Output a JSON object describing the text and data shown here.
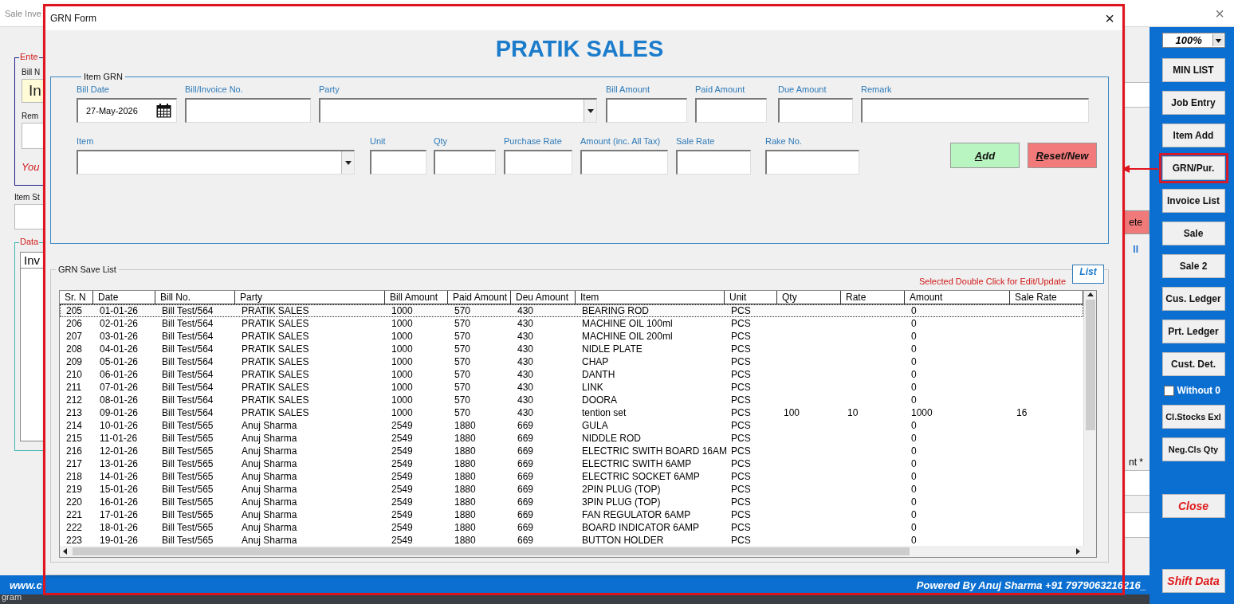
{
  "background_window": {
    "title": "Sale Inve",
    "close": "×",
    "left_fragments": {
      "entry_legend": "Ente",
      "bill_label": "Bill N",
      "bill_value": "In",
      "remark_label": "Rem",
      "note": "You",
      "stock_label": "Item St",
      "data_legend": "Data",
      "list_header": "Inv"
    },
    "right_fragments": {
      "button": "ete",
      "link": "ll",
      "label": "nt *"
    },
    "footer": {
      "website": "www.c",
      "credit": "Powered By Anuj Sharma +91 7979063216216_"
    }
  },
  "desktop_text": "gram",
  "sidebar": {
    "zoom": "100%",
    "items": [
      {
        "kind": "button",
        "label": "MIN LIST",
        "highlighted": false
      },
      {
        "kind": "button",
        "label": "Job Entry",
        "highlighted": false
      },
      {
        "kind": "button",
        "label": "Item Add",
        "highlighted": false
      },
      {
        "kind": "button",
        "label": "GRN/Pur.",
        "highlighted": true
      },
      {
        "kind": "button",
        "label": "Invoice List",
        "highlighted": false
      },
      {
        "kind": "button",
        "label": "Sale",
        "highlighted": false
      },
      {
        "kind": "button",
        "label": "Sale 2",
        "highlighted": false
      },
      {
        "kind": "button",
        "label": "Cus. Ledger",
        "highlighted": false
      },
      {
        "kind": "button",
        "label": "Prt. Ledger",
        "highlighted": false
      },
      {
        "kind": "button",
        "label": "Cust. Det.",
        "highlighted": false
      },
      {
        "kind": "checkbox",
        "label": "Without 0",
        "checked": false
      },
      {
        "kind": "small",
        "label": "Cl.Stocks Exl",
        "highlighted": false
      },
      {
        "kind": "small",
        "label": "Neg.Cls Qty",
        "highlighted": false
      },
      {
        "kind": "danger",
        "label": "Close",
        "highlighted": false
      },
      {
        "kind": "danger",
        "label": "Shift Data",
        "highlighted": false
      }
    ]
  },
  "dialog": {
    "title": "GRN Form",
    "close": "×",
    "heading": "PRATIK SALES",
    "item_grn": {
      "legend": "Item GRN",
      "row_1": [
        {
          "kind": "date",
          "label": "Bill Date",
          "value": "27-May-2026"
        },
        {
          "kind": "text",
          "label": "Bill/Invoice No."
        },
        {
          "kind": "combo",
          "label": "Party"
        },
        {
          "kind": "text",
          "label": "Bill Amount"
        },
        {
          "kind": "text",
          "label": "Paid Amount"
        },
        {
          "kind": "text",
          "label": "Due Amount"
        },
        {
          "kind": "text",
          "label": "Remark"
        }
      ],
      "row_2": [
        {
          "kind": "combo",
          "label": "Item"
        },
        {
          "kind": "text",
          "label": "Unit"
        },
        {
          "kind": "text",
          "label": "Qty"
        },
        {
          "kind": "text",
          "label": "Purchase Rate"
        },
        {
          "kind": "text",
          "label": "Amount (inc. All Tax)"
        },
        {
          "kind": "text",
          "label": "Sale Rate"
        },
        {
          "kind": "text",
          "label": "Rake No."
        }
      ],
      "buttons": [
        {
          "kind": "add",
          "label": "Add"
        },
        {
          "kind": "reset",
          "label": "Reset/New"
        }
      ]
    },
    "save_list": {
      "legend": "GRN Save List",
      "note": "Selected Double Click for Edit/Update",
      "list_button": "List",
      "columns": [
        "Sr. N",
        "Date",
        "Bill No.",
        "Party",
        "Bill Amount",
        "Paid Amount",
        "Deu Amount",
        "Item",
        "Unit",
        "Qty",
        "Rate",
        "Amount",
        "Sale Rate"
      ],
      "rows": [
        {
          "selected": true,
          "sr": "205",
          "date": "01-01-26",
          "bill_no": "Bill Test/564",
          "party": "PRATIK SALES",
          "bill_amount": "1000",
          "paid_amount": "570",
          "due_amount": "430",
          "item": "BEARING ROD",
          "unit": "PCS",
          "amount": "0"
        },
        {
          "selected": false,
          "sr": "206",
          "date": "02-01-26",
          "bill_no": "Bill Test/564",
          "party": "PRATIK SALES",
          "bill_amount": "1000",
          "paid_amount": "570",
          "due_amount": "430",
          "item": "MACHINE OIL 100ml",
          "unit": "PCS",
          "amount": "0"
        },
        {
          "selected": false,
          "sr": "207",
          "date": "03-01-26",
          "bill_no": "Bill Test/564",
          "party": "PRATIK SALES",
          "bill_amount": "1000",
          "paid_amount": "570",
          "due_amount": "430",
          "item": "MACHINE OIL 200ml",
          "unit": "PCS",
          "amount": "0"
        },
        {
          "selected": false,
          "sr": "208",
          "date": "04-01-26",
          "bill_no": "Bill Test/564",
          "party": "PRATIK SALES",
          "bill_amount": "1000",
          "paid_amount": "570",
          "due_amount": "430",
          "item": "NIDLE PLATE",
          "unit": "PCS",
          "amount": "0"
        },
        {
          "selected": false,
          "sr": "209",
          "date": "05-01-26",
          "bill_no": "Bill Test/564",
          "party": "PRATIK SALES",
          "bill_amount": "1000",
          "paid_amount": "570",
          "due_amount": "430",
          "item": "CHAP",
          "unit": "PCS",
          "amount": "0"
        },
        {
          "selected": false,
          "sr": "210",
          "date": "06-01-26",
          "bill_no": "Bill Test/564",
          "party": "PRATIK SALES",
          "bill_amount": "1000",
          "paid_amount": "570",
          "due_amount": "430",
          "item": "DANTH",
          "unit": "PCS",
          "amount": "0"
        },
        {
          "selected": false,
          "sr": "211",
          "date": "07-01-26",
          "bill_no": "Bill Test/564",
          "party": "PRATIK SALES",
          "bill_amount": "1000",
          "paid_amount": "570",
          "due_amount": "430",
          "item": "LINK",
          "unit": "PCS",
          "amount": "0"
        },
        {
          "selected": false,
          "sr": "212",
          "date": "08-01-26",
          "bill_no": "Bill Test/564",
          "party": "PRATIK SALES",
          "bill_amount": "1000",
          "paid_amount": "570",
          "due_amount": "430",
          "item": "DOORA",
          "unit": "PCS",
          "amount": "0"
        },
        {
          "selected": false,
          "sr": "213",
          "date": "09-01-26",
          "bill_no": "Bill Test/564",
          "party": "PRATIK SALES",
          "bill_amount": "1000",
          "paid_amount": "570",
          "due_amount": "430",
          "item": "tention set",
          "unit": "PCS",
          "qty": "100",
          "rate": "10",
          "amount": "1000",
          "sale_rate": "16"
        },
        {
          "selected": false,
          "sr": "214",
          "date": "10-01-26",
          "bill_no": "Bill Test/565",
          "party": "Anuj Sharma",
          "bill_amount": "2549",
          "paid_amount": "1880",
          "due_amount": "669",
          "item": "GULA",
          "unit": "PCS",
          "amount": "0"
        },
        {
          "selected": false,
          "sr": "215",
          "date": "11-01-26",
          "bill_no": "Bill Test/565",
          "party": "Anuj Sharma",
          "bill_amount": "2549",
          "paid_amount": "1880",
          "due_amount": "669",
          "item": "NIDDLE ROD",
          "unit": "PCS",
          "amount": "0"
        },
        {
          "selected": false,
          "sr": "216",
          "date": "12-01-26",
          "bill_no": "Bill Test/565",
          "party": "Anuj Sharma",
          "bill_amount": "2549",
          "paid_amount": "1880",
          "due_amount": "669",
          "item": "ELECTRIC SWITH BOARD 16AM",
          "unit": "PCS",
          "amount": "0"
        },
        {
          "selected": false,
          "sr": "217",
          "date": "13-01-26",
          "bill_no": "Bill Test/565",
          "party": "Anuj Sharma",
          "bill_amount": "2549",
          "paid_amount": "1880",
          "due_amount": "669",
          "item": "ELECTRIC SWITH 6AMP",
          "unit": "PCS",
          "amount": "0"
        },
        {
          "selected": false,
          "sr": "218",
          "date": "14-01-26",
          "bill_no": "Bill Test/565",
          "party": "Anuj Sharma",
          "bill_amount": "2549",
          "paid_amount": "1880",
          "due_amount": "669",
          "item": "ELECTRIC SOCKET 6AMP",
          "unit": "PCS",
          "amount": "0"
        },
        {
          "selected": false,
          "sr": "219",
          "date": "15-01-26",
          "bill_no": "Bill Test/565",
          "party": "Anuj Sharma",
          "bill_amount": "2549",
          "paid_amount": "1880",
          "due_amount": "669",
          "item": "2PIN PLUG (TOP)",
          "unit": "PCS",
          "amount": "0"
        },
        {
          "selected": false,
          "sr": "220",
          "date": "16-01-26",
          "bill_no": "Bill Test/565",
          "party": "Anuj Sharma",
          "bill_amount": "2549",
          "paid_amount": "1880",
          "due_amount": "669",
          "item": "3PIN PLUG (TOP)",
          "unit": "PCS",
          "amount": "0"
        },
        {
          "selected": false,
          "sr": "221",
          "date": "17-01-26",
          "bill_no": "Bill Test/565",
          "party": "Anuj Sharma",
          "bill_amount": "2549",
          "paid_amount": "1880",
          "due_amount": "669",
          "item": "FAN REGULATOR 6AMP",
          "unit": "PCS",
          "amount": "0"
        },
        {
          "selected": false,
          "sr": "222",
          "date": "18-01-26",
          "bill_no": "Bill Test/565",
          "party": "Anuj Sharma",
          "bill_amount": "2549",
          "paid_amount": "1880",
          "due_amount": "669",
          "item": "BOARD INDICATOR 6AMP",
          "unit": "PCS",
          "amount": "0"
        },
        {
          "selected": false,
          "sr": "223",
          "date": "19-01-26",
          "bill_no": "Bill Test/565",
          "party": "Anuj Sharma",
          "bill_amount": "2549",
          "paid_amount": "1880",
          "due_amount": "669",
          "item": "BUTTON HOLDER",
          "unit": "PCS",
          "amount": "0"
        }
      ]
    }
  }
}
